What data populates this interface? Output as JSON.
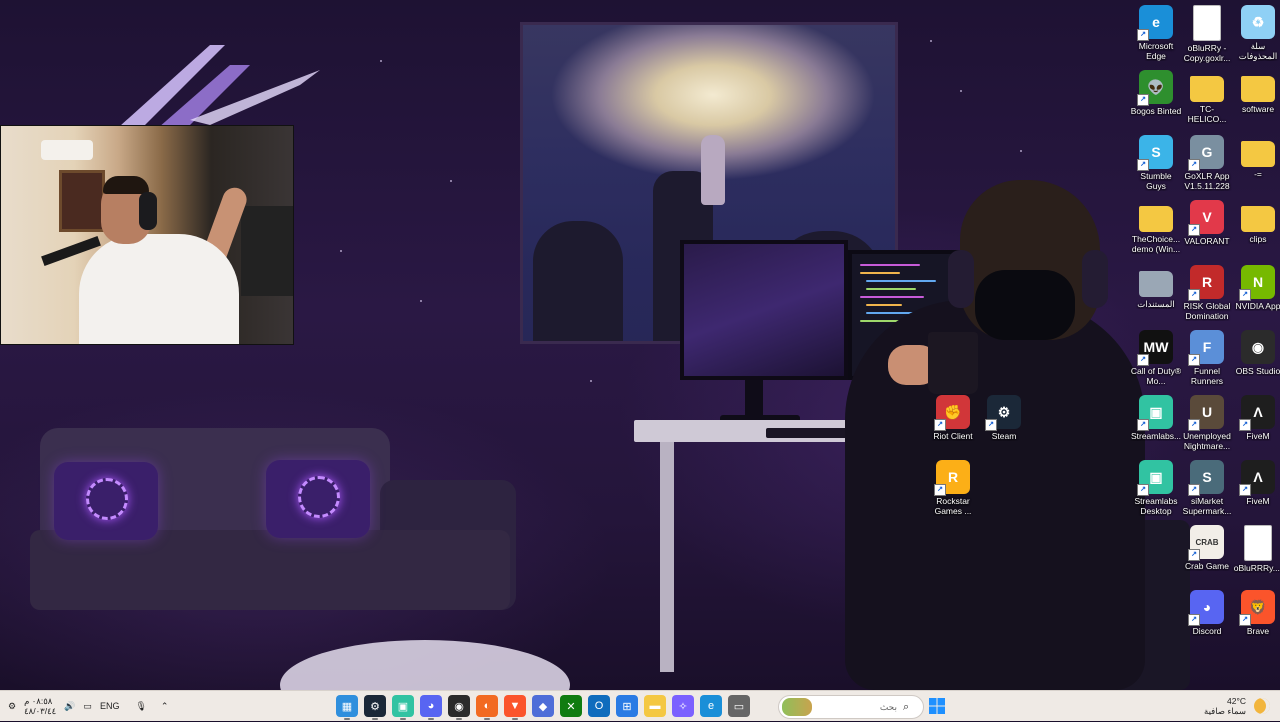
{
  "desktop_icons": [
    {
      "id": "edge",
      "label": "Microsoft Edge",
      "icon": "edge-icon",
      "color": "#1a8fd8",
      "glyph": "e",
      "shortcut": true
    },
    {
      "id": "goxlr-copy",
      "label": "oBluRRy - Copy.goxlr...",
      "icon": "file-icon",
      "color": "#ffffff",
      "glyph": "",
      "shortcut": false
    },
    {
      "id": "recycle",
      "label": "سلة المحذوفات",
      "icon": "recycle-bin-icon",
      "color": "#8fd0f5",
      "glyph": "♻",
      "shortcut": false
    },
    {
      "id": "bogos",
      "label": "Bogos Binted",
      "icon": "alien-icon",
      "color": "#2e8f2e",
      "glyph": "👽",
      "shortcut": true
    },
    {
      "id": "tchelicon",
      "label": "TC-HELICO...",
      "icon": "folder-icon",
      "color": "#f4c842",
      "glyph": "",
      "shortcut": false
    },
    {
      "id": "software",
      "label": "software",
      "icon": "folder-icon",
      "color": "#f4c842",
      "glyph": "",
      "shortcut": false
    },
    {
      "id": "stumble",
      "label": "Stumble Guys",
      "icon": "stumble-guys-icon",
      "color": "#3bb4e8",
      "glyph": "S",
      "shortcut": true
    },
    {
      "id": "goxlr",
      "label": "GoXLR App V1.5.11.228",
      "icon": "goxlr-icon",
      "color": "#7a8fa0",
      "glyph": "G",
      "shortcut": true
    },
    {
      "id": "dash",
      "label": "-=",
      "icon": "folder-icon",
      "color": "#f4c842",
      "glyph": "",
      "shortcut": false
    },
    {
      "id": "thechoice",
      "label": "TheChoice... demo (Win...",
      "icon": "folder-icon",
      "color": "#f4c842",
      "glyph": "",
      "shortcut": false
    },
    {
      "id": "valorant",
      "label": "VALORANT",
      "icon": "valorant-icon",
      "color": "#e2394a",
      "glyph": "V",
      "shortcut": true
    },
    {
      "id": "clips",
      "label": "clips",
      "icon": "folder-icon",
      "color": "#f4c842",
      "glyph": "",
      "shortcut": false
    },
    {
      "id": "documents",
      "label": "المستندات",
      "icon": "documents-folder-icon",
      "color": "#9aa7b5",
      "glyph": "",
      "shortcut": false
    },
    {
      "id": "risk",
      "label": "RISK Global Domination",
      "icon": "risk-icon",
      "color": "#c22a2a",
      "glyph": "R",
      "shortcut": true
    },
    {
      "id": "nvidia",
      "label": "NVIDIA App",
      "icon": "nvidia-icon",
      "color": "#76b900",
      "glyph": "N",
      "shortcut": true
    },
    {
      "id": "cod",
      "label": "Call of Duty® Mo...",
      "icon": "call-of-duty-icon",
      "color": "#111111",
      "glyph": "MW",
      "shortcut": true
    },
    {
      "id": "funnel",
      "label": "Funnel Runners",
      "icon": "funnel-runners-icon",
      "color": "#5b8fd8",
      "glyph": "F",
      "shortcut": true
    },
    {
      "id": "obs",
      "label": "OBS Studio",
      "icon": "obs-icon",
      "color": "#2b2b2b",
      "glyph": "◉",
      "shortcut": false
    },
    {
      "id": "riot",
      "label": "Riot Client",
      "icon": "riot-client-icon",
      "color": "#d13639",
      "glyph": "✊",
      "shortcut": true
    },
    {
      "id": "steam",
      "label": "Steam",
      "icon": "steam-icon",
      "color": "#1b2838",
      "glyph": "⚙",
      "shortcut": true
    },
    {
      "id": "streamlabs1",
      "label": "Streamlabs...",
      "icon": "streamlabs-icon",
      "color": "#31c3a2",
      "glyph": "▣",
      "shortcut": true
    },
    {
      "id": "unemployed",
      "label": "Unemployed Nightmare...",
      "icon": "unemployed-nightmare-icon",
      "color": "#5a4a3a",
      "glyph": "U",
      "shortcut": true
    },
    {
      "id": "fivem1",
      "label": "FiveM",
      "icon": "fivem-icon",
      "color": "#1e1e1e",
      "glyph": "Λ",
      "shortcut": true
    },
    {
      "id": "rockstar",
      "label": "Rockstar Games ...",
      "icon": "rockstar-icon",
      "color": "#fcaf17",
      "glyph": "R",
      "shortcut": true
    },
    {
      "id": "streamlabs2",
      "label": "Streamlabs Desktop",
      "icon": "streamlabs-icon",
      "color": "#31c3a2",
      "glyph": "▣",
      "shortcut": true
    },
    {
      "id": "simarket",
      "label": "siMarket Supermark...",
      "icon": "simarket-icon",
      "color": "#4a6b7a",
      "glyph": "S",
      "shortcut": true
    },
    {
      "id": "fivem2",
      "label": "FiveM",
      "icon": "fivem-icon",
      "color": "#1e1e1e",
      "glyph": "Λ",
      "shortcut": true
    },
    {
      "id": "crab",
      "label": "Crab Game",
      "icon": "crab-game-icon",
      "color": "#f2eee8",
      "glyph": "CRAB",
      "shortcut": true
    },
    {
      "id": "oblurrry",
      "label": "oBluRRRy....",
      "icon": "file-icon",
      "color": "#ffffff",
      "glyph": "",
      "shortcut": false
    },
    {
      "id": "discord",
      "label": "Discord",
      "icon": "discord-icon",
      "color": "#5865f2",
      "glyph": "◕",
      "shortcut": true
    },
    {
      "id": "brave",
      "label": "Brave",
      "icon": "brave-icon",
      "color": "#fb542b",
      "glyph": "🦁",
      "shortcut": true
    }
  ],
  "taskbar": {
    "left": {
      "datetime_line1": "٠٨:٥٨ م",
      "datetime_line2": "٤٨/٠٣/٤٤",
      "language": "ENG"
    },
    "search_placeholder": "بحث",
    "weather_temp": "42°C",
    "weather_desc": "سماء صافية",
    "apps": [
      {
        "name": "photos",
        "icon": "photos-icon",
        "color": "#2f8fdd",
        "glyph": "▦"
      },
      {
        "name": "steam",
        "icon": "steam-icon",
        "color": "#1b2838",
        "glyph": "⚙"
      },
      {
        "name": "streamlabs",
        "icon": "streamlabs-icon",
        "color": "#31c3a2",
        "glyph": "▣"
      },
      {
        "name": "discord",
        "icon": "discord-icon",
        "color": "#5865f2",
        "glyph": "◕"
      },
      {
        "name": "obs",
        "icon": "obs-icon",
        "color": "#2b2b2b",
        "glyph": "◉"
      },
      {
        "name": "origin",
        "icon": "app-icon",
        "color": "#f26a21",
        "glyph": "◐"
      },
      {
        "name": "brave",
        "icon": "brave-icon",
        "color": "#fb542b",
        "glyph": "▼"
      },
      {
        "name": "vscode",
        "icon": "app-icon",
        "color": "#4f6ed8",
        "glyph": "◆"
      },
      {
        "name": "xbox",
        "icon": "xbox-icon",
        "color": "#107c10",
        "glyph": "✕"
      },
      {
        "name": "outlook",
        "icon": "outlook-icon",
        "color": "#0f6cbd",
        "glyph": "O"
      },
      {
        "name": "store",
        "icon": "microsoft-store-icon",
        "color": "#2a7be4",
        "glyph": "⊞"
      },
      {
        "name": "explorer",
        "icon": "file-explorer-icon",
        "color": "#f4c842",
        "glyph": "▬"
      },
      {
        "name": "copilot",
        "icon": "copilot-icon",
        "color": "#7b61ff",
        "glyph": "✧"
      },
      {
        "name": "edge",
        "icon": "edge-icon",
        "color": "#1a8fd8",
        "glyph": "e"
      },
      {
        "name": "terminal",
        "icon": "app-icon",
        "color": "#666666",
        "glyph": "▭"
      }
    ]
  }
}
